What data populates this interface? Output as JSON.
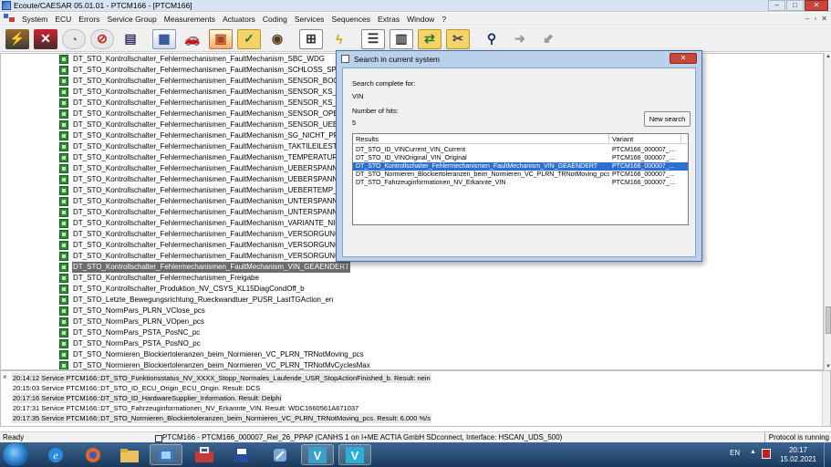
{
  "window": {
    "title": "Ecoute/CAESAR 05.01.01 - PTCM166 - [PTCM166]",
    "min": "–",
    "max": "□",
    "close": "✕"
  },
  "menubar": {
    "items": [
      "System",
      "ECU",
      "Errors",
      "Service Group",
      "Measurements",
      "Actuators",
      "Coding",
      "Services",
      "Sequences",
      "Extras",
      "Window",
      "?"
    ],
    "mdi_min": "–",
    "mdi_restore": "▫",
    "mdi_close": "✕"
  },
  "toolbar": {
    "icons": [
      "connect-icon",
      "disconnect-icon",
      "gauge-icon",
      "gauge-off-icon",
      "ecu-icon",
      "flash-icon",
      "car-icon",
      "measure-icon",
      "folder-check-icon",
      "eye-icon",
      "compare-icon",
      "lightning-icon",
      "list-icon",
      "table-icon",
      "sequence-icon",
      "tools-icon",
      "binoculars-icon",
      "export-icon",
      "import-icon"
    ]
  },
  "tree": {
    "items": [
      "DT_STO_Kontrollschalter_Fehlermechanismen_FaultMechanism_SBC_WDG",
      "DT_STO_Kontrollschalter_Fehlermechanismen_FaultMechanism_SCHLOSS_SPIELS",
      "DT_STO_Kontrollschalter_Fehlermechanismen_FaultMechanism_SENSOR_BOOTET",
      "DT_STO_Kontrollschalter_Fehlermechanismen_FaultMechanism_SENSOR_KS_GND",
      "DT_STO_Kontrollschalter_Fehlermechanismen_FaultMechanism_SENSOR_KS_PLUS",
      "DT_STO_Kontrollschalter_Fehlermechanismen_FaultMechanism_SENSOR_OPENLO",
      "DT_STO_Kontrollschalter_Fehlermechanismen_FaultMechanism_SENSOR_UEBERST",
      "DT_STO_Kontrollschalter_Fehlermechanismen_FaultMechanism_SG_NICHT_PROG",
      "DT_STO_Kontrollschalter_Fehlermechanismen_FaultMechanism_TAKTILEILESTE_FE",
      "DT_STO_Kontrollschalter_Fehlermechanismen_FaultMechanism_TEMPERATURSEN",
      "DT_STO_Kontrollschalter_Fehlermechanismen_FaultMechanism_UEBERSPANNUNG",
      "DT_STO_Kontrollschalter_Fehlermechanismen_FaultMechanism_UEBERSPANNUNG",
      "DT_STO_Kontrollschalter_Fehlermechanismen_FaultMechanism_UEBERTEMP_SG_I",
      "DT_STO_Kontrollschalter_Fehlermechanismen_FaultMechanism_UNTERSPANNUN",
      "DT_STO_Kontrollschalter_Fehlermechanismen_FaultMechanism_UNTERSPANNUN",
      "DT_STO_Kontrollschalter_Fehlermechanismen_FaultMechanism_VARIANTE_NICHT",
      "DT_STO_Kontrollschalter_Fehlermechanismen_FaultMechanism_VERSORGUNG_HA",
      "DT_STO_Kontrollschalter_Fehlermechanismen_FaultMechanism_VERSORGUNG_PO",
      "DT_STO_Kontrollschalter_Fehlermechanismen_FaultMechanism_VERSORGUNG_TA",
      "DT_STO_Kontrollschalter_Fehlermechanismen_FaultMechanism_VIN_GEAENDERT",
      "DT_STO_Kontrollschalter_Fehlermechanismen_Freigabe",
      "DT_STO_Kontrollschalter_Produktion_NV_CSYS_KL15DiagCondOff_b",
      "DT_STO_Letzte_Bewegungsrichtung_Rueckwandtuer_PUSR_LastTGAction_en",
      "DT_STO_NormPars_PLRN_VClose_pcs",
      "DT_STO_NormPars_PLRN_VOpen_pcs",
      "DT_STO_NormPars_PSTA_PosNC_pc",
      "DT_STO_NormPars_PSTA_PosNO_pc",
      "DT_STO_Normieren_Blockiertoleranzen_beim_Normieren_VC_PLRN_TRNotMoving_pcs",
      "DT_STO_Normieren_Blockiertoleranzen_beim_Normieren_VC_PLRN_TRNotMvCyclesMax"
    ],
    "selected_index": 19
  },
  "dialog": {
    "title": "Search in current system",
    "close": "✕",
    "search_complete_label": "Search complete for:",
    "search_term": "VIN",
    "hits_label": "Number of hits:",
    "hits_value": "5",
    "new_search": "New search",
    "col_results": "Results",
    "col_variant": "Variant",
    "results": [
      {
        "name": "DT_STO_ID_VINCurrent_VIN_Current",
        "variant": "PTCM166_000007_..."
      },
      {
        "name": "DT_STO_ID_VINOriginal_VIN_Original",
        "variant": "PTCM166_000007_..."
      },
      {
        "name": "DT_STO_Kontrollschalter_Fehlermechanismen_FaultMechanism_VIN_GEAENDERT",
        "variant": "PTCM166_000007_..."
      },
      {
        "name": "DT_STO_Normieren_Blockiertoleranzen_beim_Normieren_VC_PLRN_TRNotMoving_pcs",
        "variant": "PTCM166_000007_..."
      },
      {
        "name": "DT_STO_Fahrzeuginformationen_NV_Erkannte_VIN",
        "variant": "PTCM166_000007_..."
      }
    ],
    "selected_result": 2
  },
  "log": {
    "close": "×",
    "lines": [
      "20:14:12 Service PTCM166::DT_STO_Funktionsstatus_NV_XXXX_Stopp_Normales_Laufende_USR_StopActionFinished_b. Result: nein",
      "20:15:03 Service PTCM166::DT_STO_ID_ECU_Origin_ECU_Origin. Result: DCS",
      "20:17:16 Service PTCM166::DT_STO_ID_HardwareSupplier_Information. Result: Delphi",
      "20:17:31 Service PTCM166::DT_STO_Fahrzeuginformationen_NV_Erkannte_VIN. Result: WDC1660561A671037",
      "20:17:35 Service PTCM166::DT_STO_Normieren_Blockiertoleranzen_beim_Normieren_VC_PLRN_TRNotMoving_pcs. Result: 6.000 %/s"
    ]
  },
  "status": {
    "ready": "Ready",
    "connection": "PTCM166 - PTCM166_000007_Rel_26_PPAP (CANHS 1 on I+ME ACTIA GmbH SDconnect, Interface: HSCAN_UDS_500)",
    "protocol": "Protocol is running"
  },
  "taskbar": {
    "language": "EN",
    "tray_arrow": "▲",
    "time": "20:17",
    "date": "15.02.2021",
    "apps": [
      "ie-icon",
      "firefox-icon",
      "explorer-icon",
      "media-icon",
      "toolbox-icon",
      "save-icon",
      "remote-icon",
      "vediamo-icon",
      "vector-icon"
    ]
  },
  "colors": {
    "selection": "#2b6fd6",
    "tree_selection": "#6d6d6d",
    "dialog_frame": "#b9d1ea",
    "taskbar": "#1f3f63"
  }
}
